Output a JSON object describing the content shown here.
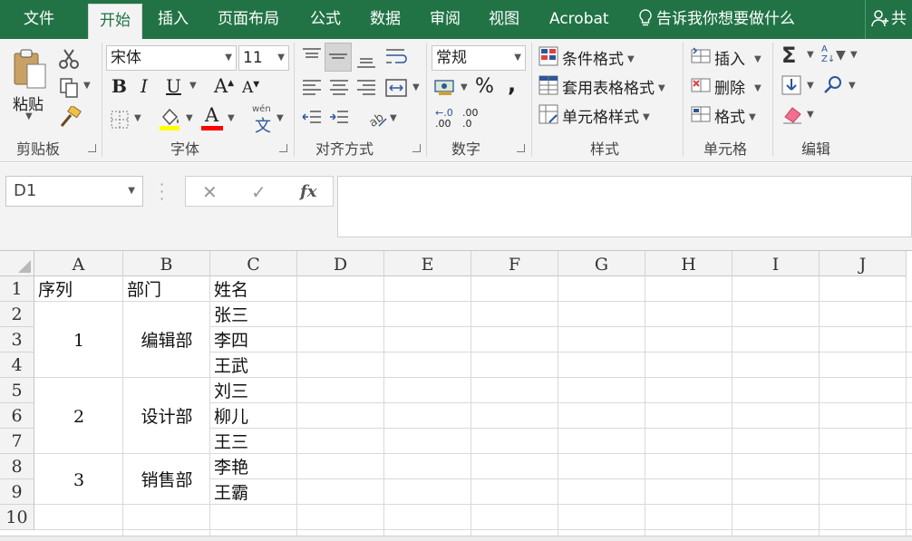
{
  "tabs": [
    {
      "label": "文件",
      "active": false
    },
    {
      "label": "开始",
      "active": true
    },
    {
      "label": "插入",
      "active": false
    },
    {
      "label": "页面布局",
      "active": false
    },
    {
      "label": "公式",
      "active": false
    },
    {
      "label": "数据",
      "active": false
    },
    {
      "label": "审阅",
      "active": false
    },
    {
      "label": "视图",
      "active": false
    },
    {
      "label": "Acrobat",
      "active": false
    }
  ],
  "tell_me": "告诉我你想要做什么",
  "share": "共",
  "ribbon": {
    "clipboard": {
      "paste": "粘贴",
      "label": "剪贴板"
    },
    "font": {
      "name": "宋体",
      "size": "11",
      "bold": "B",
      "italic": "I",
      "underline": "U",
      "grow": "A",
      "shrink": "A",
      "pinyin": "wén",
      "pinyin_char": "文",
      "label": "字体",
      "fill_color": "#ffff00",
      "font_color": "#ff0000"
    },
    "alignment": {
      "label": "对齐方式"
    },
    "number": {
      "format": "常规",
      "percent": "%",
      "comma": ",",
      "inc_dec": ".00",
      "dec_dec": ".0",
      "label": "数字"
    },
    "styles": {
      "conditional": "条件格式",
      "table": "套用表格格式",
      "cell": "单元格样式",
      "label": "样式"
    },
    "cells": {
      "insert": "插入",
      "delete": "删除",
      "format": "格式",
      "label": "单元格"
    },
    "editing": {
      "label": "编辑"
    }
  },
  "formula_bar": {
    "name_box": "D1",
    "cancel": "✕",
    "enter": "✓",
    "fx": "fx",
    "value": ""
  },
  "accent": "#217346",
  "columns": [
    "A",
    "B",
    "C",
    "D",
    "E",
    "F",
    "G",
    "H",
    "I",
    "J"
  ],
  "rows": [
    "1",
    "2",
    "3",
    "4",
    "5",
    "6",
    "7",
    "8",
    "9",
    "10"
  ],
  "cells": {
    "A1": "序列",
    "B1": "部门",
    "C1": "姓名",
    "A3": "1",
    "B3": "编辑部",
    "C2": "张三",
    "C3": "李四",
    "C4": "王武",
    "A6": "2",
    "B6": "设计部",
    "C5": "刘三",
    "C6": "柳儿",
    "C7": "王三",
    "A8": "3",
    "B8": "销售部",
    "C8": "李艳",
    "C9": "王霸"
  }
}
